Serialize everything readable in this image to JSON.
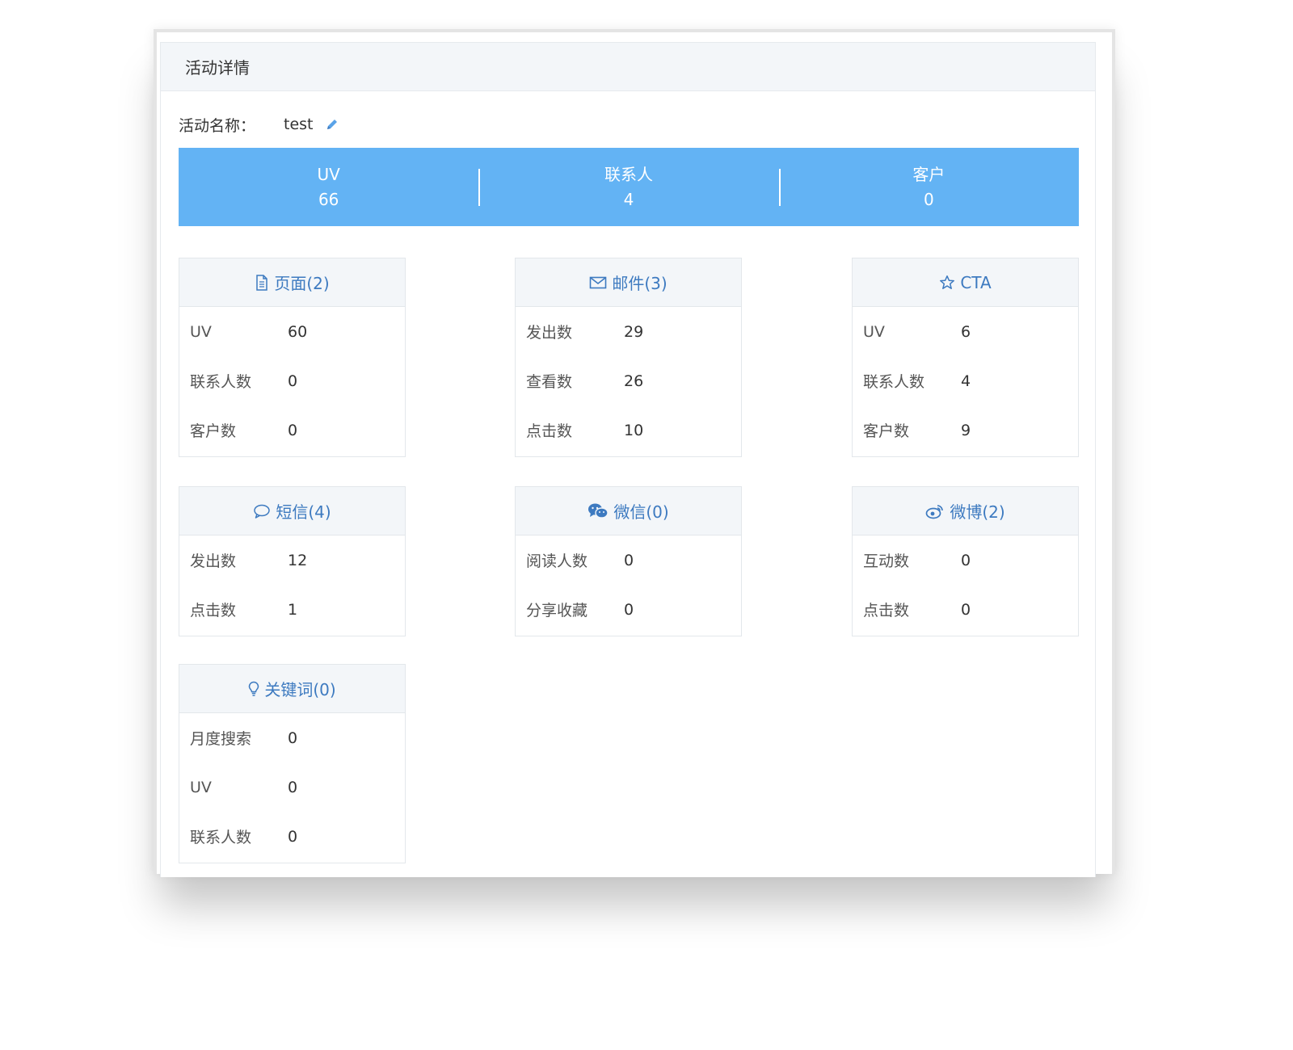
{
  "panel": {
    "title": "活动详情"
  },
  "activity": {
    "name_label": "活动名称：",
    "name_value": "test"
  },
  "stats": [
    {
      "label": "UV",
      "value": "66"
    },
    {
      "label": "联系人",
      "value": "4"
    },
    {
      "label": "客户",
      "value": "0"
    }
  ],
  "cards": [
    {
      "icon": "document-icon",
      "title": "页面(2)",
      "rows": [
        {
          "label": "UV",
          "value": "60"
        },
        {
          "label": "联系人数",
          "value": "0"
        },
        {
          "label": "客户数",
          "value": "0"
        }
      ]
    },
    {
      "icon": "envelope-icon",
      "title": "邮件(3)",
      "rows": [
        {
          "label": "发出数",
          "value": "29"
        },
        {
          "label": "查看数",
          "value": "26"
        },
        {
          "label": "点击数",
          "value": "10"
        }
      ]
    },
    {
      "icon": "star-icon",
      "title": "CTA",
      "rows": [
        {
          "label": "UV",
          "value": "6"
        },
        {
          "label": "联系人数",
          "value": "4"
        },
        {
          "label": "客户数",
          "value": "9"
        }
      ]
    },
    {
      "icon": "chat-bubble-icon",
      "title": "短信(4)",
      "rows": [
        {
          "label": "发出数",
          "value": "12"
        },
        {
          "label": "点击数",
          "value": "1"
        }
      ]
    },
    {
      "icon": "wechat-icon",
      "title": "微信(0)",
      "rows": [
        {
          "label": "阅读人数",
          "value": "0"
        },
        {
          "label": "分享收藏",
          "value": "0"
        }
      ]
    },
    {
      "icon": "weibo-icon",
      "title": "微博(2)",
      "rows": [
        {
          "label": "互动数",
          "value": "0"
        },
        {
          "label": "点击数",
          "value": "0"
        }
      ]
    },
    {
      "icon": "lightbulb-icon",
      "title": "关键词(0)",
      "rows": [
        {
          "label": "月度搜索",
          "value": "0"
        },
        {
          "label": "UV",
          "value": "0"
        },
        {
          "label": "联系人数",
          "value": "0"
        }
      ]
    }
  ],
  "colors": {
    "accent": "#63b3f4",
    "link": "#3d7ac0",
    "header_bg": "#f3f6f9"
  }
}
